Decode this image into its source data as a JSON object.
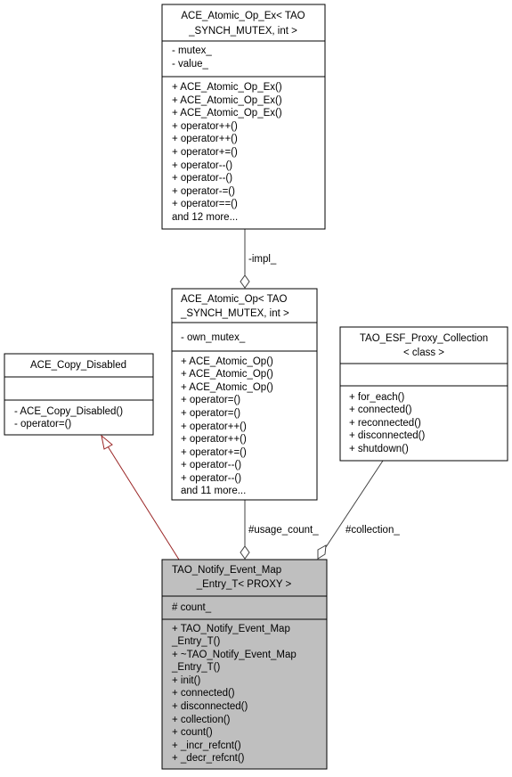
{
  "diagram": {
    "classes": {
      "atomic_op_ex": {
        "title": [
          "ACE_Atomic_Op_Ex< TAO",
          "_SYNCH_MUTEX, int >"
        ],
        "attributes": [
          "- mutex_",
          "- value_"
        ],
        "methods": [
          "+ ACE_Atomic_Op_Ex()",
          "+ ACE_Atomic_Op_Ex()",
          "+ ACE_Atomic_Op_Ex()",
          "+ operator++()",
          "+ operator++()",
          "+ operator+=()",
          "+ operator--()",
          "+ operator--()",
          "+ operator-=()",
          "+ operator==()",
          "and 12 more..."
        ]
      },
      "atomic_op": {
        "title": [
          "ACE_Atomic_Op< TAO",
          "_SYNCH_MUTEX, int >"
        ],
        "attributes": [
          "- own_mutex_"
        ],
        "methods": [
          "+ ACE_Atomic_Op()",
          "+ ACE_Atomic_Op()",
          "+ ACE_Atomic_Op()",
          "+ operator=()",
          "+ operator=()",
          "+ operator++()",
          "+ operator++()",
          "+ operator+=()",
          "+ operator--()",
          "+ operator--()",
          "and 11 more..."
        ]
      },
      "copy_disabled": {
        "title": [
          "ACE_Copy_Disabled"
        ],
        "attributes": [],
        "methods": [
          "- ACE_Copy_Disabled()",
          "- operator=()"
        ]
      },
      "proxy_collection": {
        "title": [
          "TAO_ESF_Proxy_Collection",
          "< class >"
        ],
        "attributes": [],
        "methods": [
          "+ for_each()",
          "+ connected()",
          "+ reconnected()",
          "+ disconnected()",
          "+ shutdown()"
        ]
      },
      "event_map_entry": {
        "title": [
          "TAO_Notify_Event_Map",
          "_Entry_T< PROXY >"
        ],
        "attributes": [
          "# count_"
        ],
        "methods": [
          "+ TAO_Notify_Event_Map",
          "_Entry_T()",
          "+ ~TAO_Notify_Event_Map",
          "_Entry_T()",
          "+ init()",
          "+ connected()",
          "+ disconnected()",
          "+ collection()",
          "+ count()",
          "+ _incr_refcnt()",
          "+ _decr_refcnt()"
        ]
      }
    },
    "edges": {
      "impl": "-impl_",
      "usage_count": "#usage_count_",
      "collection": "#collection_"
    },
    "colors": {
      "focus_fill": "#bfbfbf",
      "inheritance_edge": "#9a2525",
      "composition_edge": "#404040"
    }
  }
}
